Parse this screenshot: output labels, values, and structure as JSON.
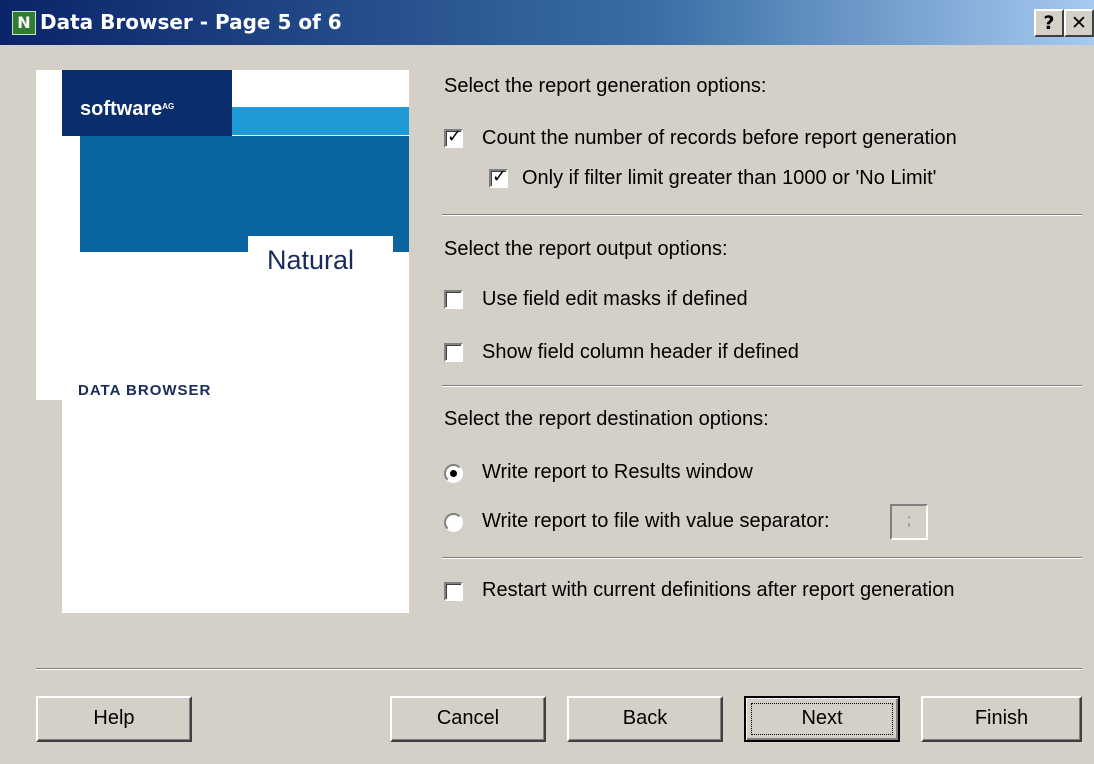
{
  "window": {
    "title": "Data Browser - Page 5 of 6",
    "app_icon_letter": "N",
    "help_glyph": "?",
    "close_glyph": "✕"
  },
  "banner": {
    "brand_logo": "software",
    "brand_suffix": "AG",
    "product": "Natural",
    "caption": "DATA BROWSER"
  },
  "generation": {
    "heading": "Select the report generation options:",
    "count_records": {
      "label": "Count the number of records before report generation",
      "checked": true
    },
    "filter_limit": {
      "label": "Only if filter limit greater than 1000 or 'No Limit'",
      "checked": true
    }
  },
  "output": {
    "heading": "Select the report output options:",
    "edit_masks": {
      "label": "Use field edit masks if defined",
      "checked": false
    },
    "column_header": {
      "label": "Show field column header if defined",
      "checked": false
    }
  },
  "destination": {
    "heading": "Select the report destination options:",
    "results_window": {
      "label": "Write report to Results window",
      "selected": true
    },
    "to_file": {
      "label": "Write report to file with value separator:",
      "selected": false
    },
    "separator_value": ";"
  },
  "restart": {
    "label": "Restart with current definitions after report generation",
    "checked": false
  },
  "buttons": {
    "help": "Help",
    "cancel": "Cancel",
    "back": "Back",
    "next": "Next",
    "finish": "Finish"
  },
  "colors": {
    "titlebar_start": "#0a246a",
    "dialog_bg": "#d4d0c8",
    "brand_dark": "#0a2d6e",
    "brand_blue": "#0a64a0",
    "brand_cyan": "#1f9ad6"
  }
}
